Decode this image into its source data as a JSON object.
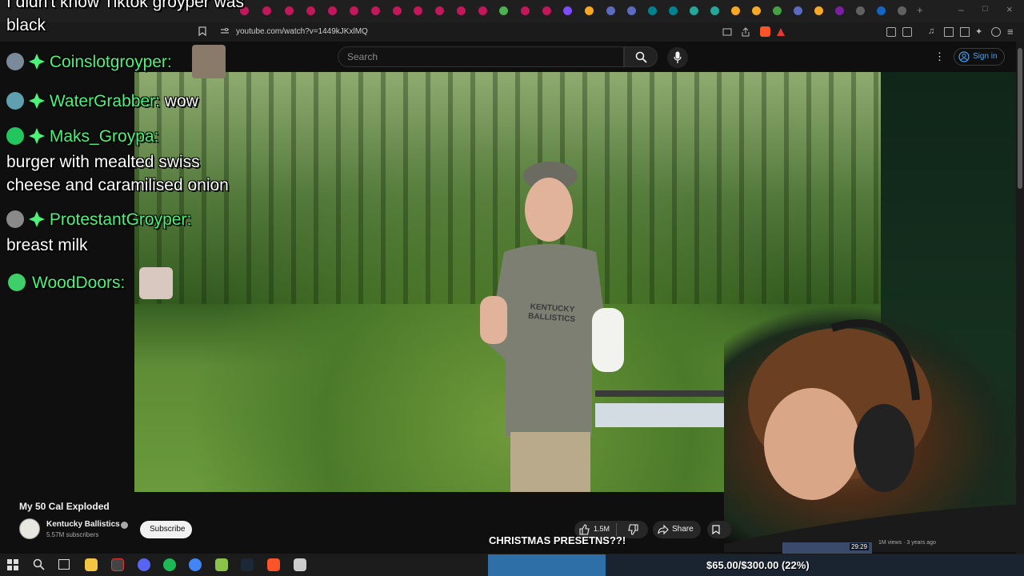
{
  "browser": {
    "url": "youtube.com/watch?v=1449kJKxlMQ"
  },
  "youtube": {
    "search_placeholder": "Search",
    "signin_label": "Sign in",
    "video_title": "My 50 Cal Exploded",
    "channel_name": "Kentucky Ballistics",
    "channel_subscribers": "5.57M subscribers",
    "subscribe_label": "Subscribe",
    "like_count": "1.5M",
    "share_label": "Share",
    "shirt_text": "KENTUCKY BALLISTICS",
    "related_duration": "29:29",
    "related_meta": "1M views · 3 years ago"
  },
  "stream_overlay": {
    "top_message_line1": "I didn't know Tiktok groyper was",
    "top_message_line2": "black",
    "chat": [
      {
        "user": "Coinslotgroyper:",
        "message": ""
      },
      {
        "user": "WaterGrabber:",
        "message": "wow"
      },
      {
        "user": "Maks_Groypa:",
        "message": "burger with mealted swiss cheese and caramilised onion"
      },
      {
        "user": "ProtestantGroyper:",
        "message": "breast milk"
      },
      {
        "user": "WoodDoors:",
        "message": ""
      }
    ],
    "ticker_text": "CHRISTMAS PRESETNS??!",
    "goal_text": "$65.00/$300.00 (22%)",
    "goal_fraction": 0.22
  },
  "colors": {
    "chat_username": "#4cf27a",
    "youtube_link": "#3ea6ff",
    "goal_fill": "#2f6fa8"
  }
}
